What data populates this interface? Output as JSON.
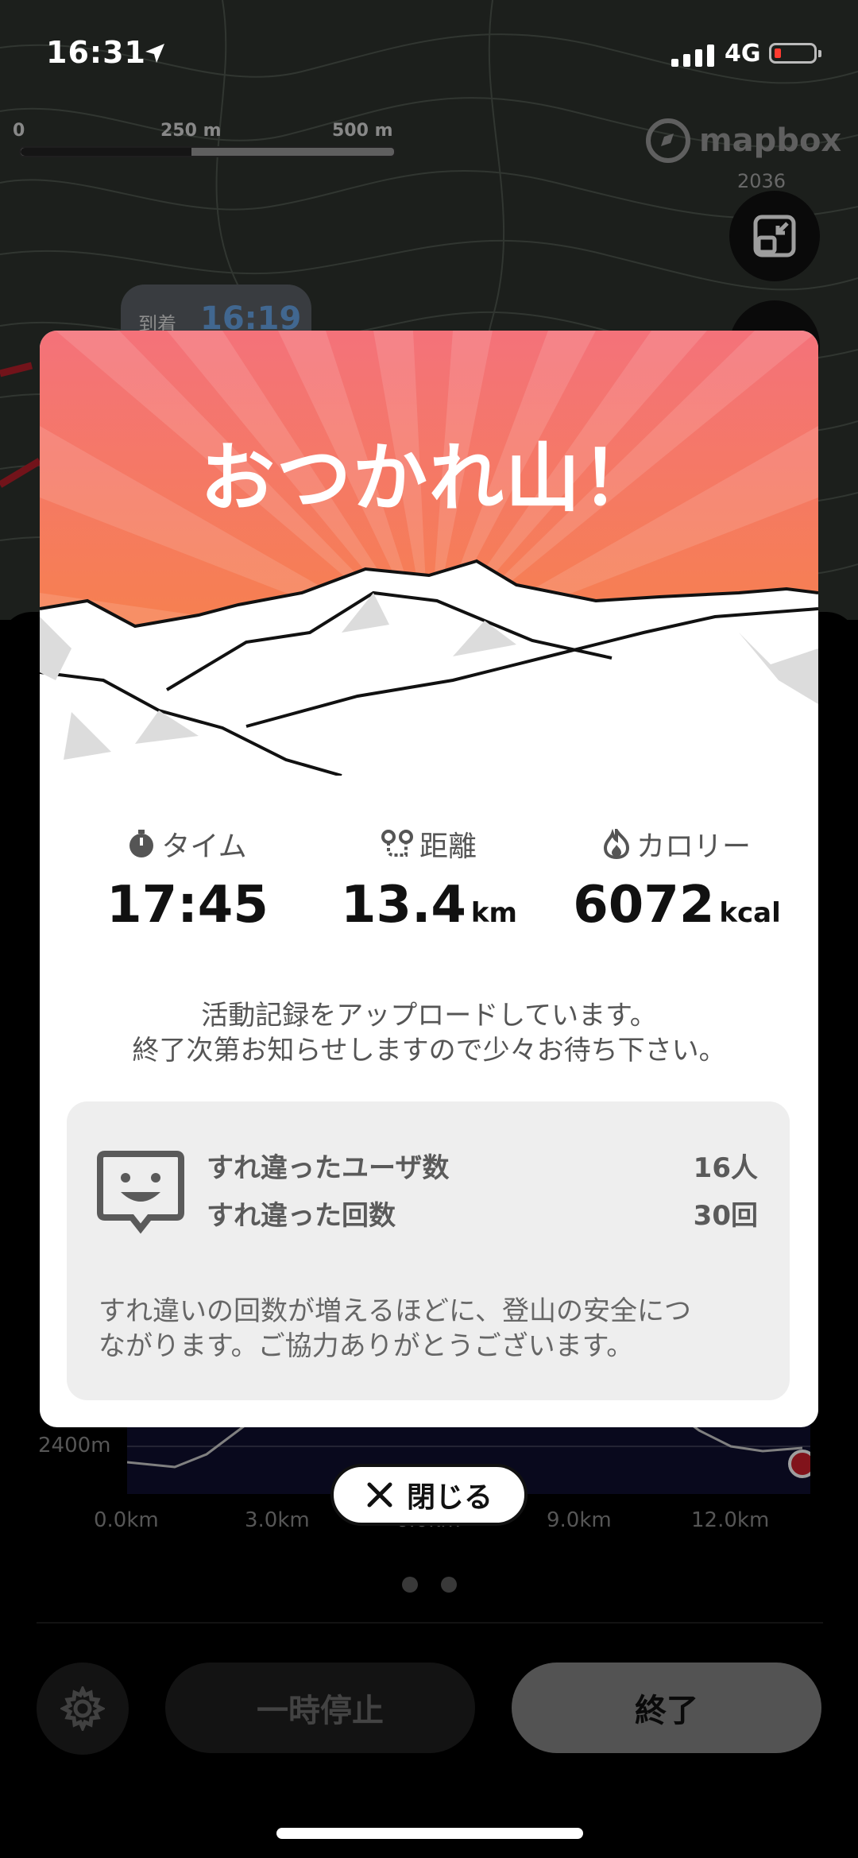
{
  "status_bar": {
    "time": "16:31",
    "network": "4G",
    "battery_color": "#ff3b30"
  },
  "map": {
    "scale_labels": [
      "0",
      "250 m",
      "500 m"
    ],
    "attribution": "mapbox",
    "elevation_label": "2036",
    "arrival": {
      "label": "到着",
      "time": "16:19"
    },
    "buttons": [
      "collapse-icon",
      "layers-icon"
    ]
  },
  "modal": {
    "title": "おつかれ山！",
    "stats": [
      {
        "icon": "stopwatch-icon",
        "label": "タイム",
        "value": "17:45",
        "unit": ""
      },
      {
        "icon": "route-icon",
        "label": "距離",
        "value": "13.4",
        "unit": "km"
      },
      {
        "icon": "flame-icon",
        "label": "カロリー",
        "value": "6072",
        "unit": "kcal"
      }
    ],
    "upload_message": {
      "line1": "活動記録をアップロードしています。",
      "line2": "終了次第お知らせしますので少々お待ち下さい。"
    },
    "passing": {
      "users_label": "すれ違ったユーザ数",
      "users_value": "16人",
      "count_label": "すれ違った回数",
      "count_value": "30回",
      "note_line1": "すれ違いの回数が増えるほどに、登山の安全につ",
      "note_line2": "ながります。ご協力ありがとうございます。"
    },
    "close_label": "閉じる"
  },
  "elevation_chart": {
    "y_label": "2400m",
    "x_ticks": [
      "0.0km",
      "3.0km",
      "6.0km",
      "9.0km",
      "12.0km"
    ]
  },
  "pager": {
    "pages": 2,
    "current": 1
  },
  "controls": {
    "pause_label": "一時停止",
    "end_label": "終了"
  },
  "colors": {
    "hero_top": "#f4727a",
    "hero_bottom": "#f7873a",
    "accent_blue": "#6aa6e8",
    "marker_red": "#d0202c"
  }
}
